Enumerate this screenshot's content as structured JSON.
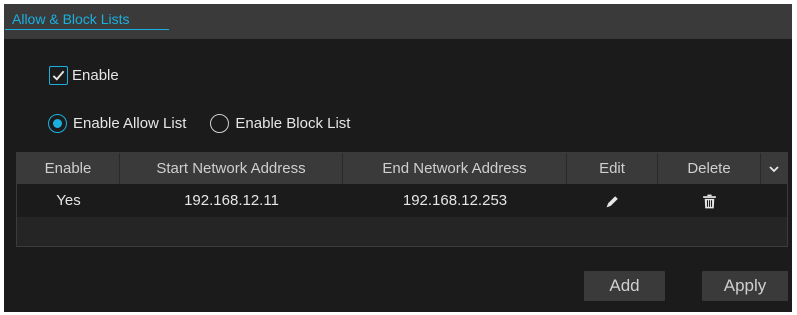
{
  "tab": {
    "label": "Allow & Block Lists"
  },
  "enable_checkbox": {
    "label": "Enable",
    "checked": true
  },
  "mode_radios": {
    "options": [
      {
        "label": "Enable Allow List",
        "selected": true
      },
      {
        "label": "Enable Block List",
        "selected": false
      }
    ]
  },
  "table": {
    "columns": [
      "Enable",
      "Start Network Address",
      "End Network Address",
      "Edit",
      "Delete"
    ],
    "rows": [
      {
        "enable": "Yes",
        "start": "192.168.12.11",
        "end": "192.168.12.253",
        "edit_icon": "pencil-icon",
        "delete_icon": "trash-icon"
      }
    ]
  },
  "buttons": {
    "add": "Add",
    "apply": "Apply"
  },
  "colors": {
    "accent": "#1ab0e0",
    "background": "#1b1b1b",
    "panel": "#3a3a3a",
    "text": "#e6e6e6"
  }
}
